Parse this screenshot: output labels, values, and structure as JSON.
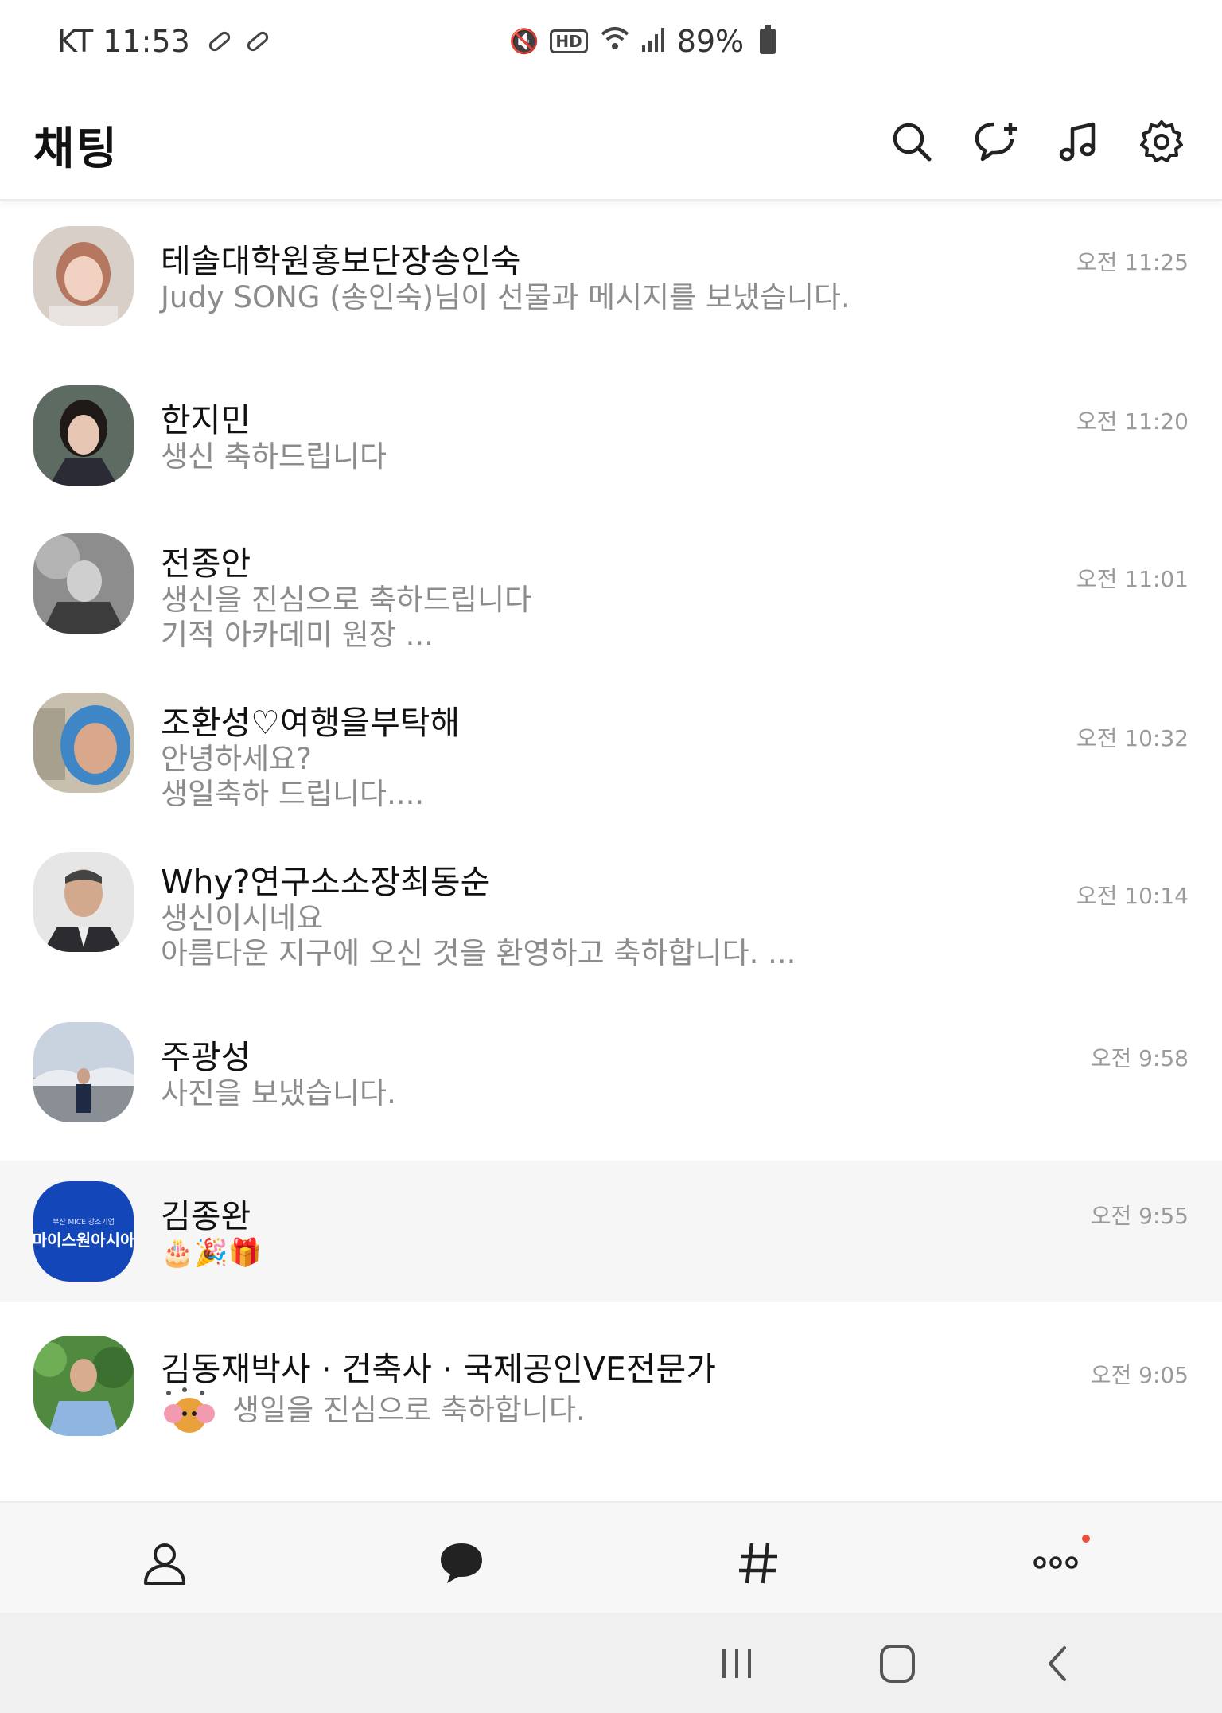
{
  "status_bar": {
    "carrier_time": "KT 11:53",
    "battery_text": "89%",
    "hd_label": "HD",
    "icons": [
      "pill-icon",
      "pill-icon",
      "mute-vibrate-icon",
      "hd-voice-icon",
      "wifi-icon",
      "signal-icon",
      "battery-charging-icon"
    ]
  },
  "header": {
    "title": "채팅",
    "icons": [
      "search-icon",
      "new-chat-icon",
      "music-icon",
      "settings-icon"
    ]
  },
  "chats": [
    {
      "name": "테솔대학원홍보단장송인숙",
      "messages": [
        "Judy SONG (송인숙)님이 선물과 메시지를 보냈습니다."
      ],
      "time": "오전 11:25"
    },
    {
      "name": "한지민",
      "messages": [
        "생신 축하드립니다"
      ],
      "time": "오전 11:20"
    },
    {
      "name": "전종안",
      "messages": [
        " 생신을 진심으로 축하드립니다",
        "기적 아카데미 원장 ..."
      ],
      "time": "오전 11:01"
    },
    {
      "name": "조환성♡여행을부탁해",
      "messages": [
        "안녕하세요?",
        "생일축하 드립니다...."
      ],
      "time": "오전 10:32"
    },
    {
      "name": "Why?연구소소장최동순",
      "messages": [
        "생신이시네요",
        "아름다운 지구에 오신 것을 환영하고 축하합니다. ..."
      ],
      "time": "오전 10:14"
    },
    {
      "name": "주광성",
      "messages": [
        "사진을 보냈습니다."
      ],
      "time": "오전 9:58"
    },
    {
      "name": "김종완",
      "messages": [
        "🎂🎉🎁"
      ],
      "time": "오전 9:55",
      "avatar_text_small": "부산 MICE 강소기업",
      "avatar_text": "마이스원아시아"
    },
    {
      "name": "김동재박사 · 건축사 · 국제공인VE전문가",
      "messages": [
        "생일을 진심으로 축하합니다."
      ],
      "time": "오전 9:05"
    }
  ],
  "bottom_nav": {
    "items": [
      "friends-icon",
      "chats-icon",
      "hashtag-icon",
      "more-icon"
    ],
    "accent": "#e8503a"
  },
  "system_nav": [
    "recent-apps-icon",
    "home-icon",
    "back-icon"
  ]
}
